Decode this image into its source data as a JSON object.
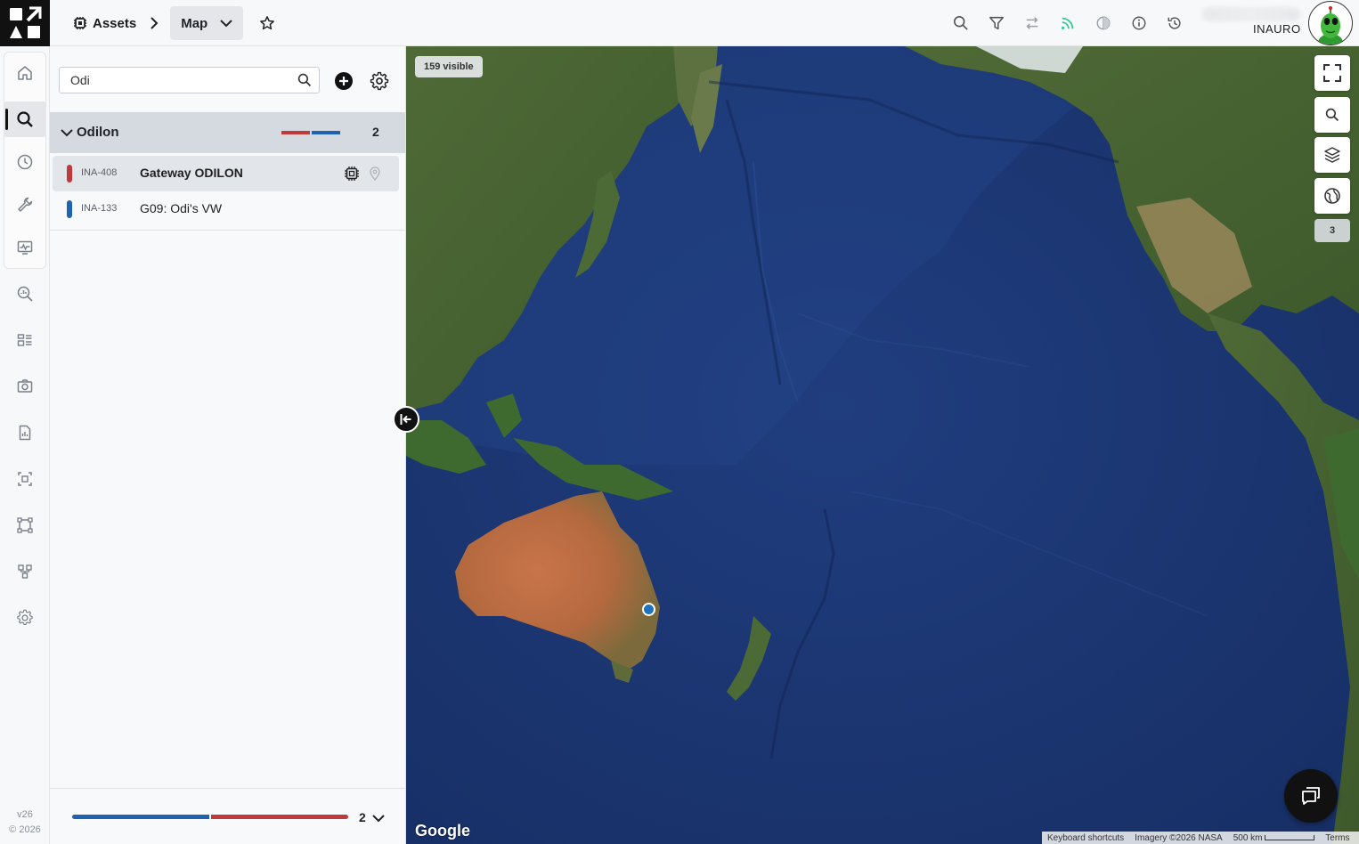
{
  "app": {
    "breadcrumb": {
      "root": "Assets",
      "current": "Map"
    },
    "org_name": "INAURO",
    "version": "v26",
    "copyright": "© 2026"
  },
  "toolbar": {
    "icons": [
      "search-icon",
      "filter-icon",
      "swap-icon",
      "signal-icon",
      "contrast-icon",
      "info-icon",
      "history-icon"
    ]
  },
  "sidebar": {
    "items": [
      {
        "name": "home-icon"
      },
      {
        "name": "search-icon",
        "active": true
      },
      {
        "name": "clock-icon"
      },
      {
        "name": "wrench-icon"
      },
      {
        "name": "monitor-icon"
      },
      {
        "name": "analytics-icon"
      },
      {
        "name": "dashboard-icon"
      },
      {
        "name": "camera-icon"
      },
      {
        "name": "report-icon"
      },
      {
        "name": "select-area-icon"
      },
      {
        "name": "frame-icon"
      },
      {
        "name": "hierarchy-icon"
      },
      {
        "name": "gear-icon"
      }
    ]
  },
  "search": {
    "value": "Odi"
  },
  "group": {
    "name": "Odilon",
    "count": "2",
    "bar_colors": [
      "#c0393b",
      "#1f62b0"
    ]
  },
  "assets": [
    {
      "code": "INA-408",
      "name": "Gateway ODILON",
      "color": "#c0393b",
      "selected": true
    },
    {
      "code": "INA-133",
      "name": "G09: Odi's VW",
      "color": "#1f62b0",
      "selected": false
    }
  ],
  "footer": {
    "count": "2"
  },
  "map": {
    "visible_label": "159 visible",
    "cluster_count": "3",
    "google_label": "Google",
    "attribution": {
      "shortcuts": "Keyboard shortcuts",
      "imagery": "Imagery ©2026 NASA",
      "scale": "500 km",
      "terms": "Terms"
    }
  }
}
